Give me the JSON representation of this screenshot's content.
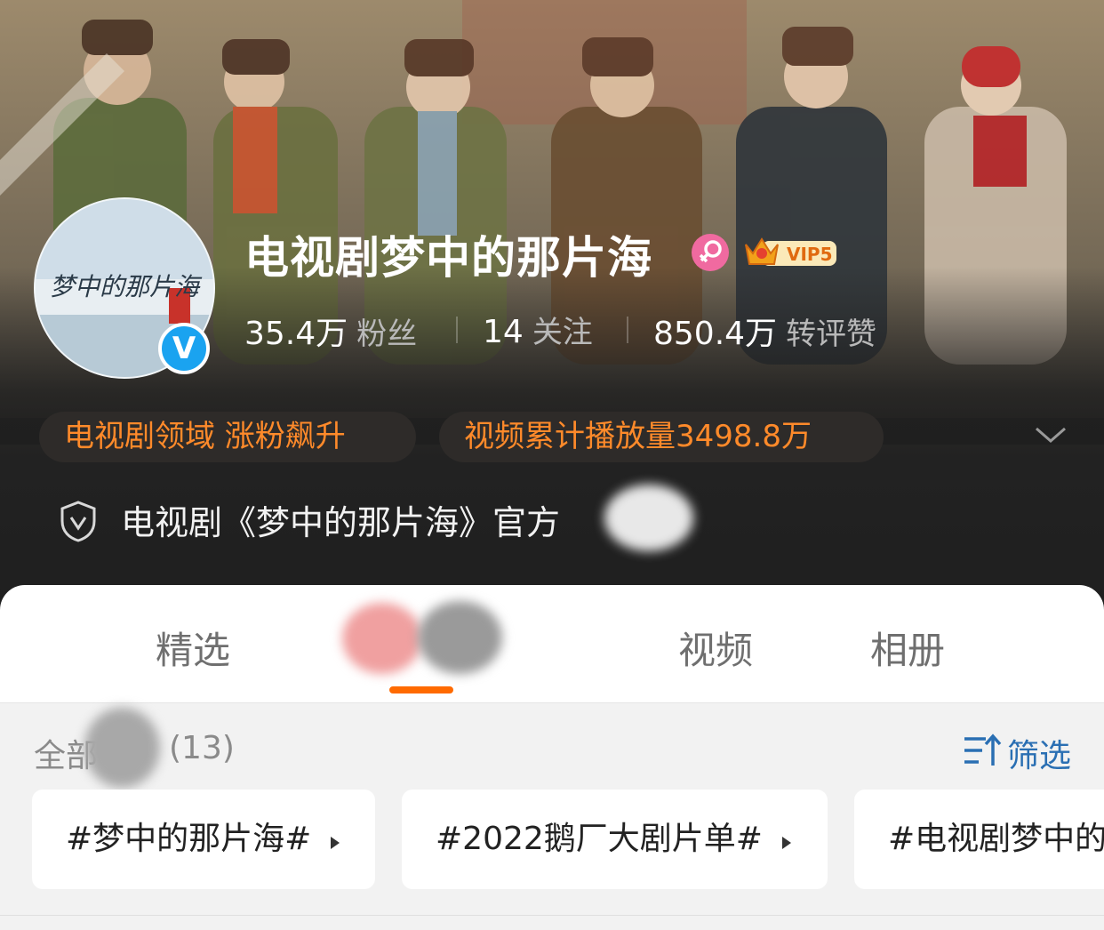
{
  "profile": {
    "name": "电视剧梦中的那片海",
    "avatar_text": "梦中的那片海",
    "verified_mark": "V",
    "vip_label": "VIP5"
  },
  "stats": [
    {
      "value": "35.4万",
      "label": "粉丝"
    },
    {
      "value": "14",
      "label": "关注"
    },
    {
      "value": "850.4万",
      "label": "转评赞"
    }
  ],
  "tags": [
    {
      "text": "电视剧领域 涨粉飙升"
    },
    {
      "text": "视频累计播放量3498.8万"
    }
  ],
  "official": {
    "text": "电视剧《梦中的那片海》官方"
  },
  "tabs": [
    {
      "label": "精选"
    },
    {
      "label": "视频"
    },
    {
      "label": "相册"
    }
  ],
  "topics_section": {
    "all_label": "全部",
    "count": "(13)",
    "filter_label": "筛选",
    "items": [
      {
        "text": "#梦中的那片海#"
      },
      {
        "text": "#2022鹅厂大剧片单#"
      },
      {
        "text": "#电视剧梦中的那片海#"
      }
    ]
  },
  "colors": {
    "accent_orange": "#ff8a2a",
    "tab_indicator": "#ff6a00",
    "verified_blue": "#1aa3f0",
    "filter_blue": "#2a6fb3"
  },
  "icons": [
    "female-icon",
    "vip-crown-icon",
    "verified-icon",
    "chevron-down-icon",
    "shield-check-icon",
    "filter-sort-icon",
    "triangle-right-icon"
  ]
}
